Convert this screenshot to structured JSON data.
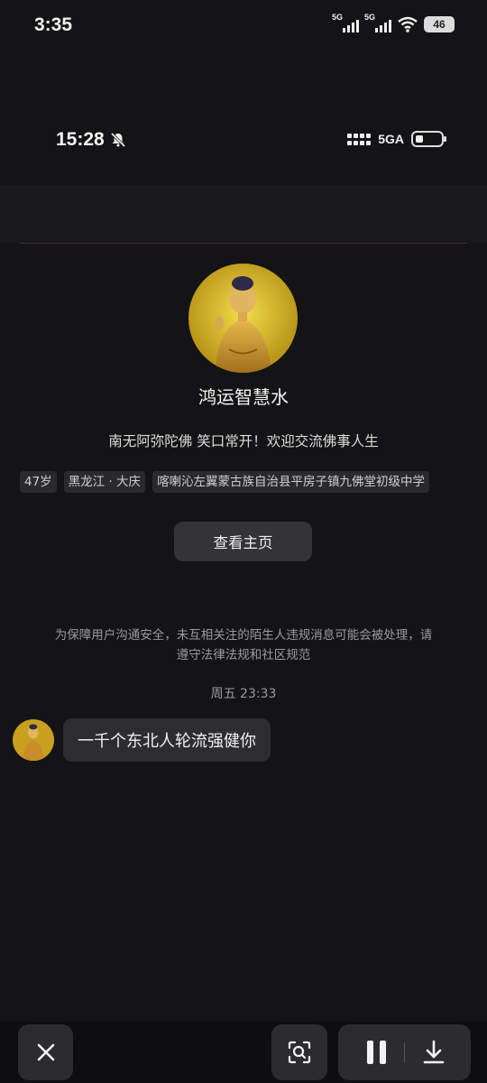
{
  "outer_status": {
    "time": "3:35",
    "net1": "5G",
    "net2": "5G",
    "battery": "46"
  },
  "inner_status": {
    "time": "15:28",
    "network": "5GA"
  },
  "profile": {
    "nickname": "鸿运智慧水",
    "bio": "南无阿弥陀佛 笑口常开！欢迎交流佛事人生",
    "tags": [
      "47岁",
      "黑龙江 · 大庆",
      "喀喇沁左翼蒙古族自治县平房子镇九佛堂初级中学"
    ],
    "home_button": "查看主页"
  },
  "notice": "为保障用户沟通安全，未互相关注的陌生人违规消息可能会被处理，请遵守法律法规和社区规范",
  "chat": {
    "timestamp": "周五 23:33",
    "messages": [
      {
        "text": "一千个东北人轮流强健你"
      }
    ]
  },
  "colors": {
    "background": "#141416",
    "bubble": "#2d2d31",
    "avatar": "#d9b52a"
  },
  "toolbar": {
    "icons": [
      "close-icon",
      "image-search-icon",
      "pause-icon",
      "download-icon"
    ]
  }
}
